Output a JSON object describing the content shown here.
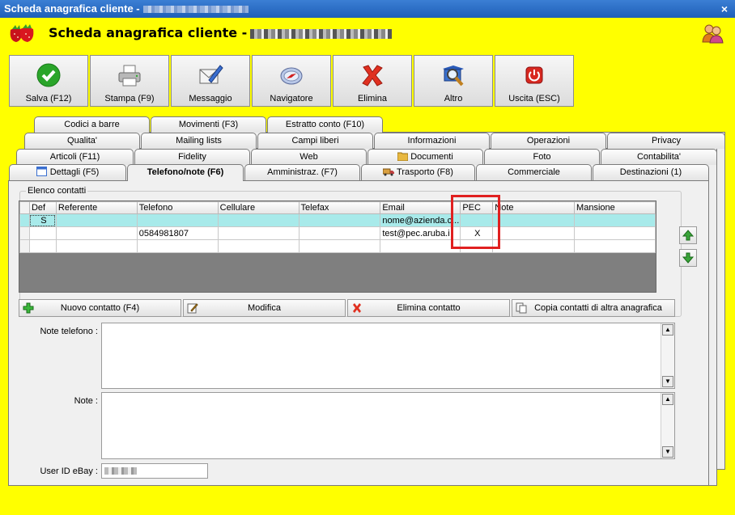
{
  "window": {
    "title": "Scheda anagrafica cliente -",
    "close_glyph": "×"
  },
  "header": {
    "title": "Scheda anagrafica cliente -"
  },
  "toolbar": [
    {
      "label": "Salva (F12)",
      "icon": "check-icon"
    },
    {
      "label": "Stampa (F9)",
      "icon": "printer-icon"
    },
    {
      "label": "Messaggio",
      "icon": "envelope-pen-icon"
    },
    {
      "label": "Navigatore",
      "icon": "compass-icon"
    },
    {
      "label": "Elimina",
      "icon": "red-x-icon"
    },
    {
      "label": "Altro",
      "icon": "magnifier-book-icon"
    },
    {
      "label": "Uscita (ESC)",
      "icon": "power-icon"
    }
  ],
  "tabs": {
    "row1": [
      "Codici a barre",
      "Movimenti (F3)",
      "Estratto conto (F10)"
    ],
    "row2": [
      "Qualita'",
      "Mailing lists",
      "Campi liberi",
      "Informazioni",
      "Operazioni",
      "Privacy"
    ],
    "row3": [
      "Articoli (F11)",
      "Fidelity",
      "Web",
      "Documenti",
      "Foto",
      "Contabilita'"
    ],
    "row4": [
      "Dettagli (F5)",
      "Telefono/note (F6)",
      "Amministraz. (F7)",
      "Trasporto (F8)",
      "Commerciale",
      "Destinazioni (1)"
    ],
    "active": "Telefono/note (F6)"
  },
  "contacts": {
    "group_label": "Elenco contatti",
    "columns": [
      "Def",
      "Referente",
      "Telefono",
      "Cellulare",
      "Telefax",
      "Email",
      "PEC",
      "Note",
      "Mansione"
    ],
    "rows": [
      [
        "S",
        "",
        "",
        "",
        "",
        "nome@azienda.c...",
        "",
        "",
        ""
      ],
      [
        "",
        "",
        "0584981807",
        "",
        "",
        "test@pec.aruba.i",
        "X",
        "",
        ""
      ],
      [
        "",
        "",
        "",
        "",
        "",
        "",
        "",
        "",
        ""
      ]
    ]
  },
  "actions": {
    "new": "Nuovo contatto (F4)",
    "edit": "Modifica",
    "delete": "Elimina contatto",
    "copy": "Copia contatti di altra anagrafica"
  },
  "fields": {
    "note_telefono_label": "Note telefono :",
    "note_label": "Note :",
    "ebay_label": "User ID eBay :"
  },
  "colors": {
    "background": "#ffff00",
    "selected_row": "#a8eaea",
    "highlight_box": "#e02020",
    "titlebar": "#2a6cc6"
  }
}
